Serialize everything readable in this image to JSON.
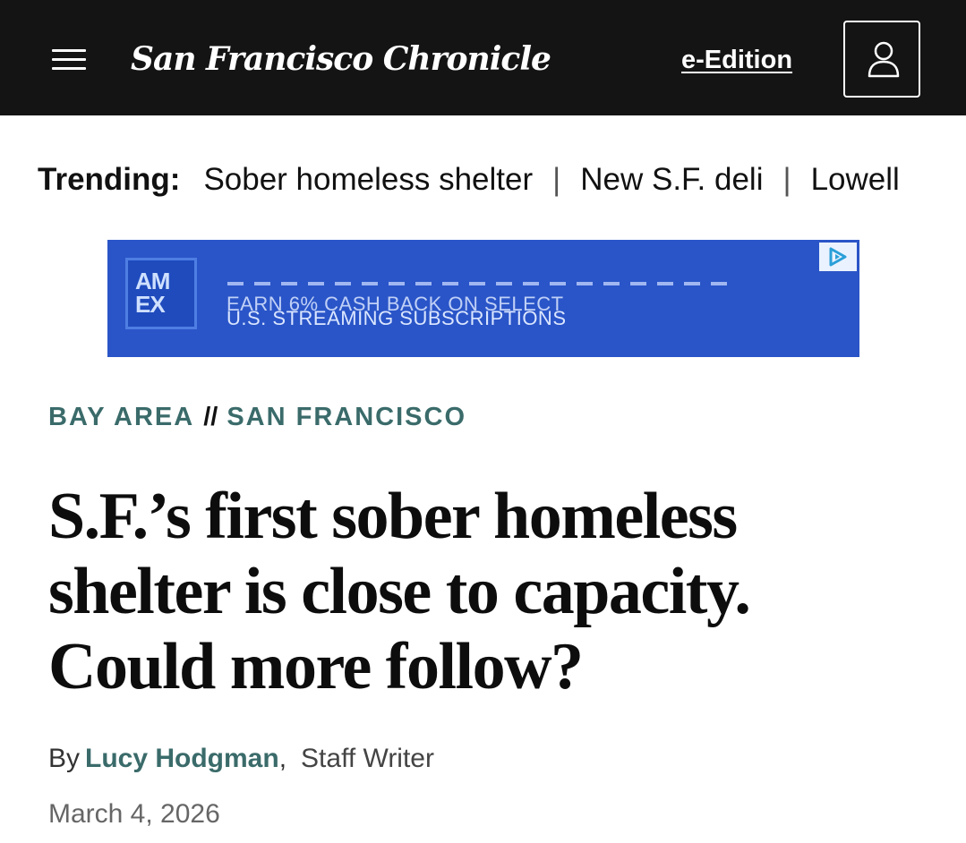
{
  "header": {
    "masthead": "San Francisco Chronicle",
    "edition_link": "e-Edition"
  },
  "trending": {
    "label": "Trending:",
    "items": [
      "Sober homeless shelter",
      "New S.F. deli",
      "Lowell"
    ],
    "separator": "|"
  },
  "ad": {
    "logo_line1": "AM",
    "logo_line2": "EX",
    "line1": "EARN 6% CASH BACK ON SELECT",
    "line2": "U.S. STREAMING SUBSCRIPTIONS",
    "background_color": "#2a55c8"
  },
  "article": {
    "section": "BAY AREA",
    "section_separator": "//",
    "subsection": "SAN FRANCISCO",
    "headline": "S.F.’s first sober homeless shelter is close to capacity. Could more follow?",
    "byline_prefix": "By",
    "author": "Lucy Hodgman",
    "byline_comma": ",",
    "author_role": "Staff Writer",
    "date": "March 4, 2026"
  },
  "colors": {
    "header_bg": "#141414",
    "accent": "#3a6b6a"
  },
  "icons": {
    "menu": "hamburger-menu-icon",
    "account": "user-account-icon",
    "ad_choices": "ad-choices-icon"
  }
}
